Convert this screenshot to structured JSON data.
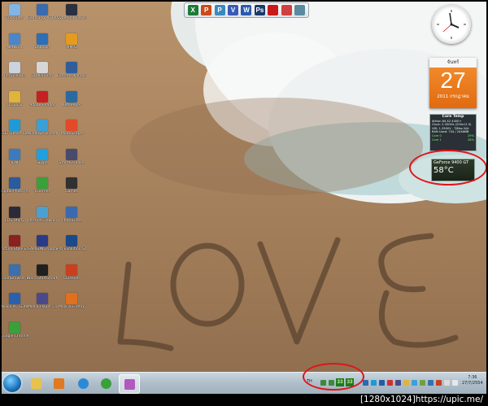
{
  "desktop": {
    "icons": [
      {
        "label": "Computer",
        "color": "#7fb6e6"
      },
      {
        "label": "Samsung PC Studio 3",
        "color": "#3a6ab0"
      },
      {
        "label": "CyberLink PowerDVD 10",
        "color": "#2a3040"
      },
      {
        "label": "Network",
        "color": "#4a86c8"
      },
      {
        "label": "Babylon",
        "color": "#2d6fb6"
      },
      {
        "label": "AIMP2",
        "color": "#e39b20"
      },
      {
        "label": "Recycle Bin",
        "color": "#c9d4dc"
      },
      {
        "label": "3DMark Pro",
        "color": "#d6d6d6"
      },
      {
        "label": "Extreme Karaoke",
        "color": "#315e9a"
      },
      {
        "label": "Dropbox",
        "color": "#e0b43a"
      },
      {
        "label": "Adobe Reader",
        "color": "#c62020"
      },
      {
        "label": "NetKeeper",
        "color": "#2a6aa0"
      },
      {
        "label": "ESET Smart Security",
        "color": "#1f9ad6"
      },
      {
        "label": "Windows Live Messenger",
        "color": "#3aa0d8"
      },
      {
        "label": "PhotoScape",
        "color": "#e24a2a"
      },
      {
        "label": "IDM",
        "color": "#3a7ac0"
      },
      {
        "label": "Skype",
        "color": "#1fa0e0"
      },
      {
        "label": "Start Karaoke",
        "color": "#4a4a6a"
      },
      {
        "label": "Digital Photo Professional",
        "color": "#2a5aa0"
      },
      {
        "label": "uTorrent",
        "color": "#3aa03a"
      },
      {
        "label": "Games",
        "color": "#303030"
      },
      {
        "label": "EOS Utility",
        "color": "#2a2a3a"
      },
      {
        "label": "Internet Download Manager",
        "color": "#4aa0d0"
      },
      {
        "label": "PhotoFiltre",
        "color": "#3a6ab0"
      },
      {
        "label": "Picture Style Editor",
        "color": "#8a2020"
      },
      {
        "label": "SAMSUNG Update Plus",
        "color": "#2a3a8a"
      },
      {
        "label": "Pro Evolution Soccer 2011",
        "color": "#1a4a8a"
      },
      {
        "label": "ZoomBrowser EX",
        "color": "#3a70b0"
      },
      {
        "label": "Nero StartSmart",
        "color": "#202020"
      },
      {
        "label": "CCleaner",
        "color": "#c84020"
      },
      {
        "label": "Nokia PC Suite",
        "color": "#2a60b0"
      },
      {
        "label": "Media Player Classic",
        "color": "#4a4a8a"
      },
      {
        "label": "Mozilla Firefox",
        "color": "#e07020"
      },
      {
        "label": "Google Chrome",
        "color": "#3aa03a"
      }
    ],
    "toolbar_buttons": [
      {
        "glyph": "X",
        "color": "#1e7a3a",
        "name": "excel"
      },
      {
        "glyph": "P",
        "color": "#c94a1a",
        "name": "powerpoint"
      },
      {
        "glyph": "P",
        "color": "#3a8ac0",
        "name": "publisher"
      },
      {
        "glyph": "V",
        "color": "#3a5ab8",
        "name": "visio"
      },
      {
        "glyph": "W",
        "color": "#2a5ab0",
        "name": "word"
      },
      {
        "glyph": "Ps",
        "color": "#1c3a6a",
        "name": "photoshop"
      },
      {
        "glyph": "",
        "color": "#c81a1a",
        "name": "acrobat"
      },
      {
        "glyph": "",
        "color": "#d04040",
        "name": "pdf"
      },
      {
        "glyph": "",
        "color": "#5a8aa0",
        "name": "network"
      }
    ]
  },
  "gadgets": {
    "calendar": {
      "day_name": "จันทร์",
      "day": "27",
      "month_year": "2011 กรกฎาคม"
    },
    "core_temp": {
      "title": "Core Temp",
      "lines": [
        "Athlon 64 X2 4400+",
        "Clock: 2.30GHz (200x11.5)",
        "VID: 1.3500V - TJMax N/A",
        "RAM Used: 734 / 2048MB"
      ],
      "cores": [
        {
          "label": "Core 0",
          "temp": "29%"
        },
        {
          "label": "Core 1",
          "temp": "28%"
        }
      ]
    },
    "gpu": {
      "name": "GeForce 9400 GT",
      "temp": "58°C"
    }
  },
  "taskbar": {
    "language": "TH",
    "tray_temps": [
      "33",
      "33"
    ],
    "time": "7:36",
    "date": "27/7/2554",
    "apps": [
      {
        "name": "explorer",
        "color": "#e8c24a"
      },
      {
        "name": "media-player",
        "color": "#e07a20"
      },
      {
        "name": "internet-explorer",
        "color": "#2a8ad8"
      },
      {
        "name": "chrome",
        "color": "#3aa03a"
      },
      {
        "name": "paint",
        "color": "#b05ac0"
      }
    ]
  },
  "caption": "[1280x1024]https://upic.me/"
}
